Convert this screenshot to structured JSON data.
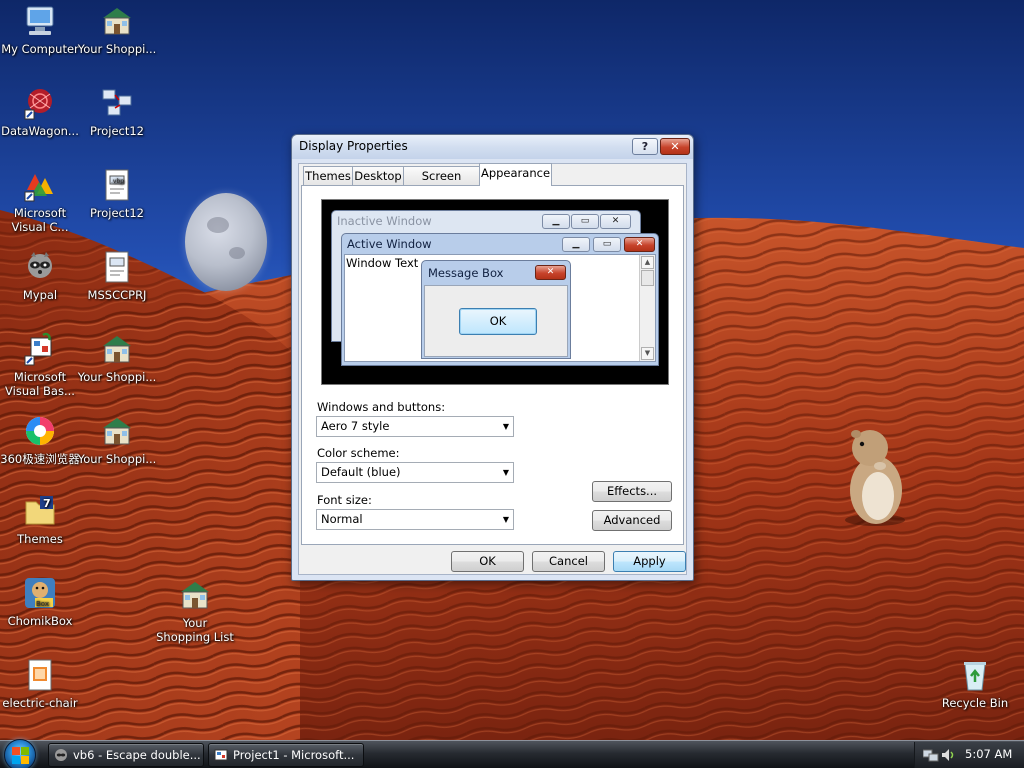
{
  "desktop": {
    "icons": [
      {
        "label": "My Computer"
      },
      {
        "label": "Your Shoppi..."
      },
      {
        "label": "DataWagon..."
      },
      {
        "label": "Project12"
      },
      {
        "label": "Microsoft Visual C..."
      },
      {
        "label": "Project12"
      },
      {
        "label": "Mypal"
      },
      {
        "label": "MSSCCPRJ"
      },
      {
        "label": "Microsoft Visual Bas..."
      },
      {
        "label": "Your Shoppi..."
      },
      {
        "label": "360极速浏览器"
      },
      {
        "label": "Your Shoppi..."
      },
      {
        "label": "Themes"
      },
      {
        "label": "ChomikBox"
      },
      {
        "label": "Your Shopping List"
      },
      {
        "label": "electric-chair"
      },
      {
        "label": "Recycle Bin"
      }
    ]
  },
  "dialog": {
    "title": "Display Properties",
    "help_label": "?",
    "close_label": "✕",
    "tabs": [
      {
        "label": "Themes"
      },
      {
        "label": "Desktop"
      },
      {
        "label": "Screen Saver"
      },
      {
        "label": "Appearance"
      }
    ],
    "active_tab": "Appearance",
    "preview": {
      "inactive_title": "Inactive Window",
      "active_title": "Active Window",
      "window_text": "Window Text",
      "message_title": "Message Box",
      "ok_label": "OK"
    },
    "windows_buttons_label": "Windows and buttons:",
    "windows_buttons_value": "Aero 7 style",
    "color_scheme_label": "Color scheme:",
    "color_scheme_value": "Default (blue)",
    "font_size_label": "Font size:",
    "font_size_value": "Normal",
    "effects_label": "Effects...",
    "advanced_label": "Advanced",
    "ok_label": "OK",
    "cancel_label": "Cancel",
    "apply_label": "Apply"
  },
  "taskbar": {
    "tasks": [
      {
        "label": "vb6 - Escape double..."
      },
      {
        "label": "Project1 - Microsoft..."
      }
    ],
    "clock": "5:07 AM"
  },
  "colors": {
    "sky": "#2f66c9",
    "sand": "#a8391a",
    "dialog_frame": "#dbe4f3",
    "accent": "#3c7fb1"
  }
}
